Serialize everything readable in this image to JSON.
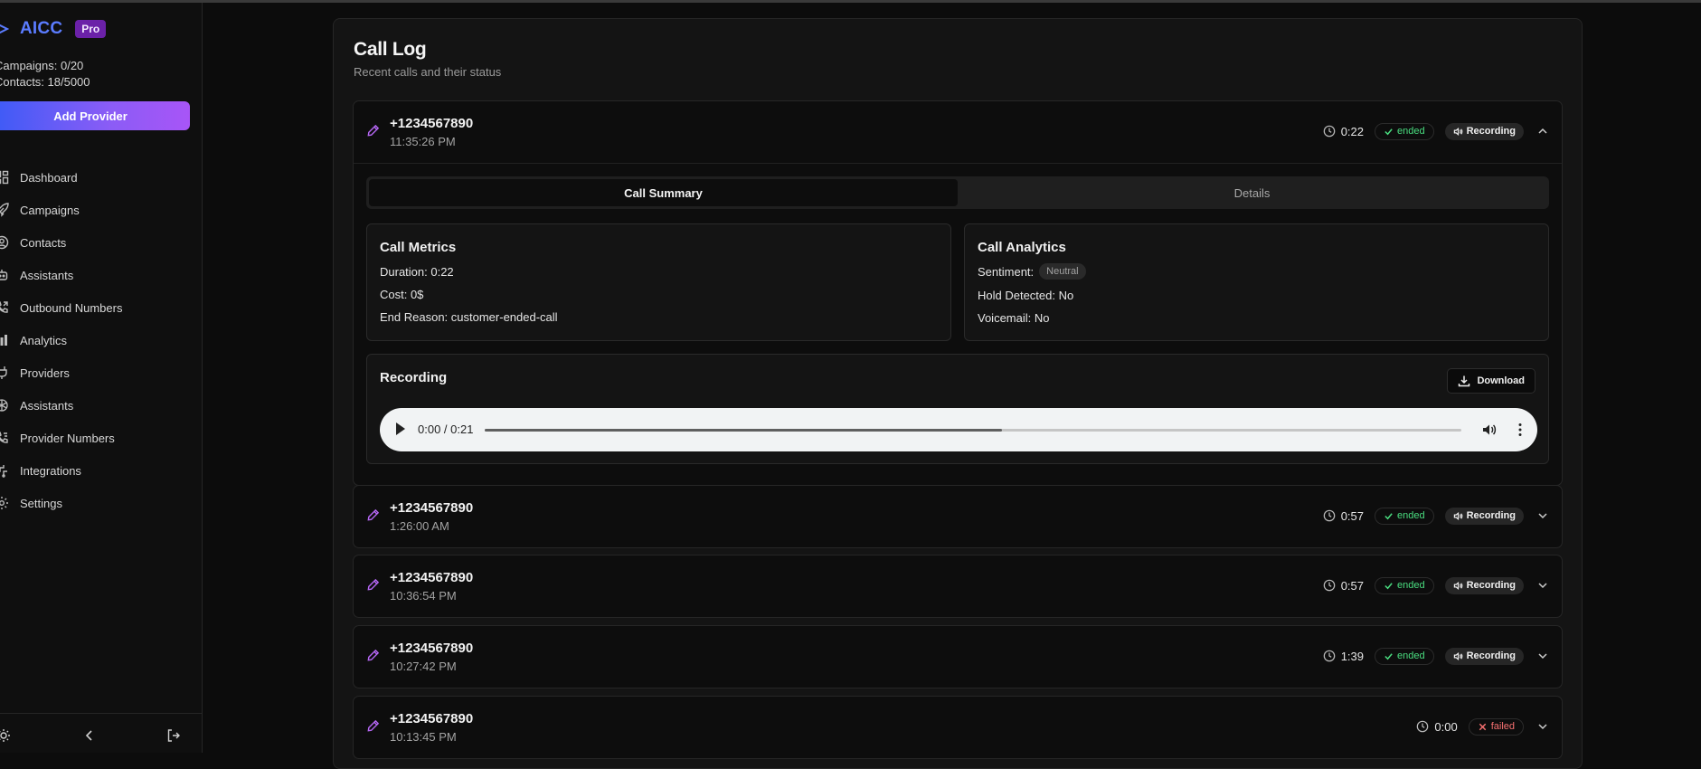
{
  "app": {
    "name": "AICC",
    "plan_badge": "Pro",
    "campaigns_stat": "Campaigns: 0/20",
    "contacts_stat": "Contacts: 18/5000",
    "add_provider_label": "Add Provider",
    "brand_color": "#5b7cff"
  },
  "sidebar": {
    "items": [
      {
        "label": "Dashboard",
        "icon": "dashboard-icon"
      },
      {
        "label": "Campaigns",
        "icon": "rocket-icon"
      },
      {
        "label": "Contacts",
        "icon": "contacts-icon"
      },
      {
        "label": "Assistants",
        "icon": "bot-icon"
      },
      {
        "label": "Outbound Numbers",
        "icon": "phone-outgoing-icon"
      },
      {
        "label": "Analytics",
        "icon": "bar-chart-icon"
      },
      {
        "label": "Providers",
        "icon": "plug-icon"
      },
      {
        "label": "Assistants",
        "icon": "openai-icon"
      },
      {
        "label": "Provider Numbers",
        "icon": "phone-list-icon"
      },
      {
        "label": "Integrations",
        "icon": "integrations-icon"
      },
      {
        "label": "Settings",
        "icon": "gear-icon"
      }
    ]
  },
  "page": {
    "title": "Call Log",
    "subtitle": "Recent calls and their status"
  },
  "calls": [
    {
      "phone": "+1234567890",
      "time": "11:35:26 PM",
      "duration": "0:22",
      "status": "ended",
      "recording": "Recording",
      "expanded": true
    },
    {
      "phone": "+1234567890",
      "time": "1:26:00 AM",
      "duration": "0:57",
      "status": "ended",
      "recording": "Recording",
      "expanded": false
    },
    {
      "phone": "+1234567890",
      "time": "10:36:54 PM",
      "duration": "0:57",
      "status": "ended",
      "recording": "Recording",
      "expanded": false
    },
    {
      "phone": "+1234567890",
      "time": "10:27:42 PM",
      "duration": "1:39",
      "status": "ended",
      "recording": "Recording",
      "expanded": false
    },
    {
      "phone": "+1234567890",
      "time": "10:13:45 PM",
      "duration": "0:00",
      "status": "failed",
      "recording": "",
      "expanded": false
    }
  ],
  "details": {
    "tabs": {
      "summary": "Call Summary",
      "details": "Details",
      "active": "summary"
    },
    "metrics": {
      "title": "Call Metrics",
      "duration": "Duration: 0:22",
      "cost": "Cost: 0$",
      "end_reason": "End Reason: customer-ended-call"
    },
    "analytics": {
      "title": "Call Analytics",
      "sentiment_label": "Sentiment:",
      "sentiment_value": "Neutral",
      "hold": "Hold Detected: No",
      "voicemail": "Voicemail: No"
    },
    "recording": {
      "title": "Recording",
      "download_label": "Download",
      "player_time": "0:00 / 0:21",
      "progress_fraction": 0.53
    }
  },
  "colors": {
    "ended": "#4ade80",
    "failed": "#f87171",
    "edit_icon": "#b667f5"
  }
}
